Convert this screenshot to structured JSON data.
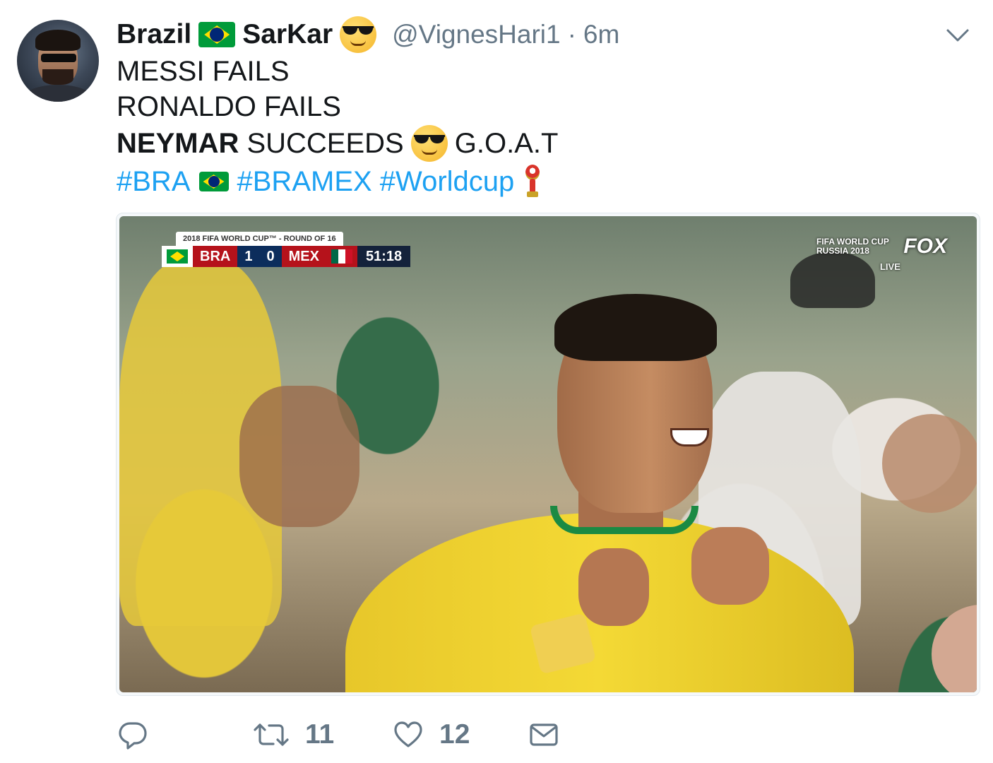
{
  "tweet": {
    "display_name_part1": "Brazil",
    "display_name_part2": "SarKar",
    "handle": "@VignesHari1",
    "separator": "·",
    "time": "6m",
    "lines": {
      "line1": "MESSI FAILS",
      "line2": "RONALDO FAILS",
      "line3_bold": "NEYMAR",
      "line3_rest": "SUCCEEDS",
      "line3_tail": "G.O.A.T"
    },
    "hashtags": [
      "#BRA",
      "#BRAMEX",
      "#Worldcup"
    ]
  },
  "media": {
    "scorebug": {
      "title": "2018 FIFA WORLD CUP™ - ROUND OF 16",
      "home_team": "BRA",
      "home_score": "1",
      "away_score": "0",
      "away_team": "MEX",
      "clock": "51:18"
    },
    "broadcast": {
      "wc_line1": "FIFA WORLD CUP",
      "wc_line2": "RUSSIA 2018",
      "network": "FOX",
      "live": "LIVE"
    }
  },
  "actions": {
    "retweets": "11",
    "likes": "12"
  },
  "icons": {
    "reply": "reply-icon",
    "retweet": "retweet-icon",
    "like": "heart-icon",
    "dm": "envelope-icon",
    "menu": "chevron-down-icon"
  },
  "colors": {
    "link": "#1da1f2",
    "secondary": "#657786",
    "text": "#14171a"
  }
}
